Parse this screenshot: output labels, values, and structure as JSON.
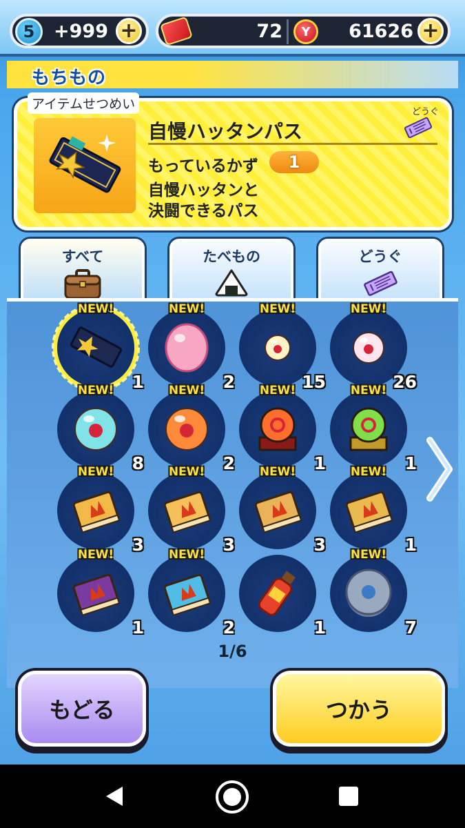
{
  "top_bar": {
    "stamina_count": "5",
    "stamina_value": "+999",
    "tickets": "72",
    "money": "61626"
  },
  "header": {
    "title": "もちもの"
  },
  "info": {
    "section_label": "アイテムせつめい",
    "item_name": "自慢ハッタンパス",
    "category_tag": "どうぐ",
    "count_label": "もっているかず",
    "count_value": "1",
    "description": "自慢ハッタンと\n決闘できるパス"
  },
  "tabs": [
    {
      "label": "すべて",
      "icon": "bag-icon"
    },
    {
      "label": "たべもの",
      "icon": "onigiri-icon"
    },
    {
      "label": "どうぐ",
      "icon": "ticket-icon"
    }
  ],
  "items": [
    {
      "new": "NEW!",
      "qty": "1",
      "icon": "pass-ticket-icon",
      "color": "#1d2950"
    },
    {
      "new": "NEW!",
      "qty": "2",
      "icon": "pink-egg-icon",
      "color": "#f7a7c4"
    },
    {
      "new": "NEW!",
      "qty": "15",
      "icon": "small-orb-icon",
      "color": "#fff3c7"
    },
    {
      "new": "NEW!",
      "qty": "26",
      "icon": "white-orb-icon",
      "color": "#ffe5ee"
    },
    {
      "new": "NEW!",
      "qty": "8",
      "icon": "blue-orb-icon",
      "color": "#7fe3e8"
    },
    {
      "new": "NEW!",
      "qty": "2",
      "icon": "orange-orb-icon",
      "color": "#ff8a3a"
    },
    {
      "new": "NEW!",
      "qty": "1",
      "icon": "crystal-ball-icon",
      "color": "#ff6e2a"
    },
    {
      "new": "NEW!",
      "qty": "1",
      "icon": "rainbow-orb-icon",
      "color": "#7fe04a"
    },
    {
      "new": "NEW!",
      "qty": "3",
      "icon": "book-icon",
      "color": "#f3b948"
    },
    {
      "new": "NEW!",
      "qty": "3",
      "icon": "book-icon",
      "color": "#f3c059"
    },
    {
      "new": "NEW!",
      "qty": "3",
      "icon": "book-icon",
      "color": "#e9b35a"
    },
    {
      "new": "NEW!",
      "qty": "1",
      "icon": "book-icon",
      "color": "#e9ba4d"
    },
    {
      "new": "NEW!",
      "qty": "1",
      "icon": "purple-book-icon",
      "color": "#7a3aa0"
    },
    {
      "new": "NEW!",
      "qty": "2",
      "icon": "blue-book-icon",
      "color": "#4fbde6"
    },
    {
      "new": "",
      "qty": "1",
      "icon": "potion-bottle-icon",
      "color": "#e8432a"
    },
    {
      "new": "NEW!",
      "qty": "7",
      "icon": "silver-coin-icon",
      "color": "#9aa9bf"
    }
  ],
  "pagination": {
    "label": "1/6"
  },
  "buttons": {
    "back": "もどる",
    "use": "つかう"
  }
}
